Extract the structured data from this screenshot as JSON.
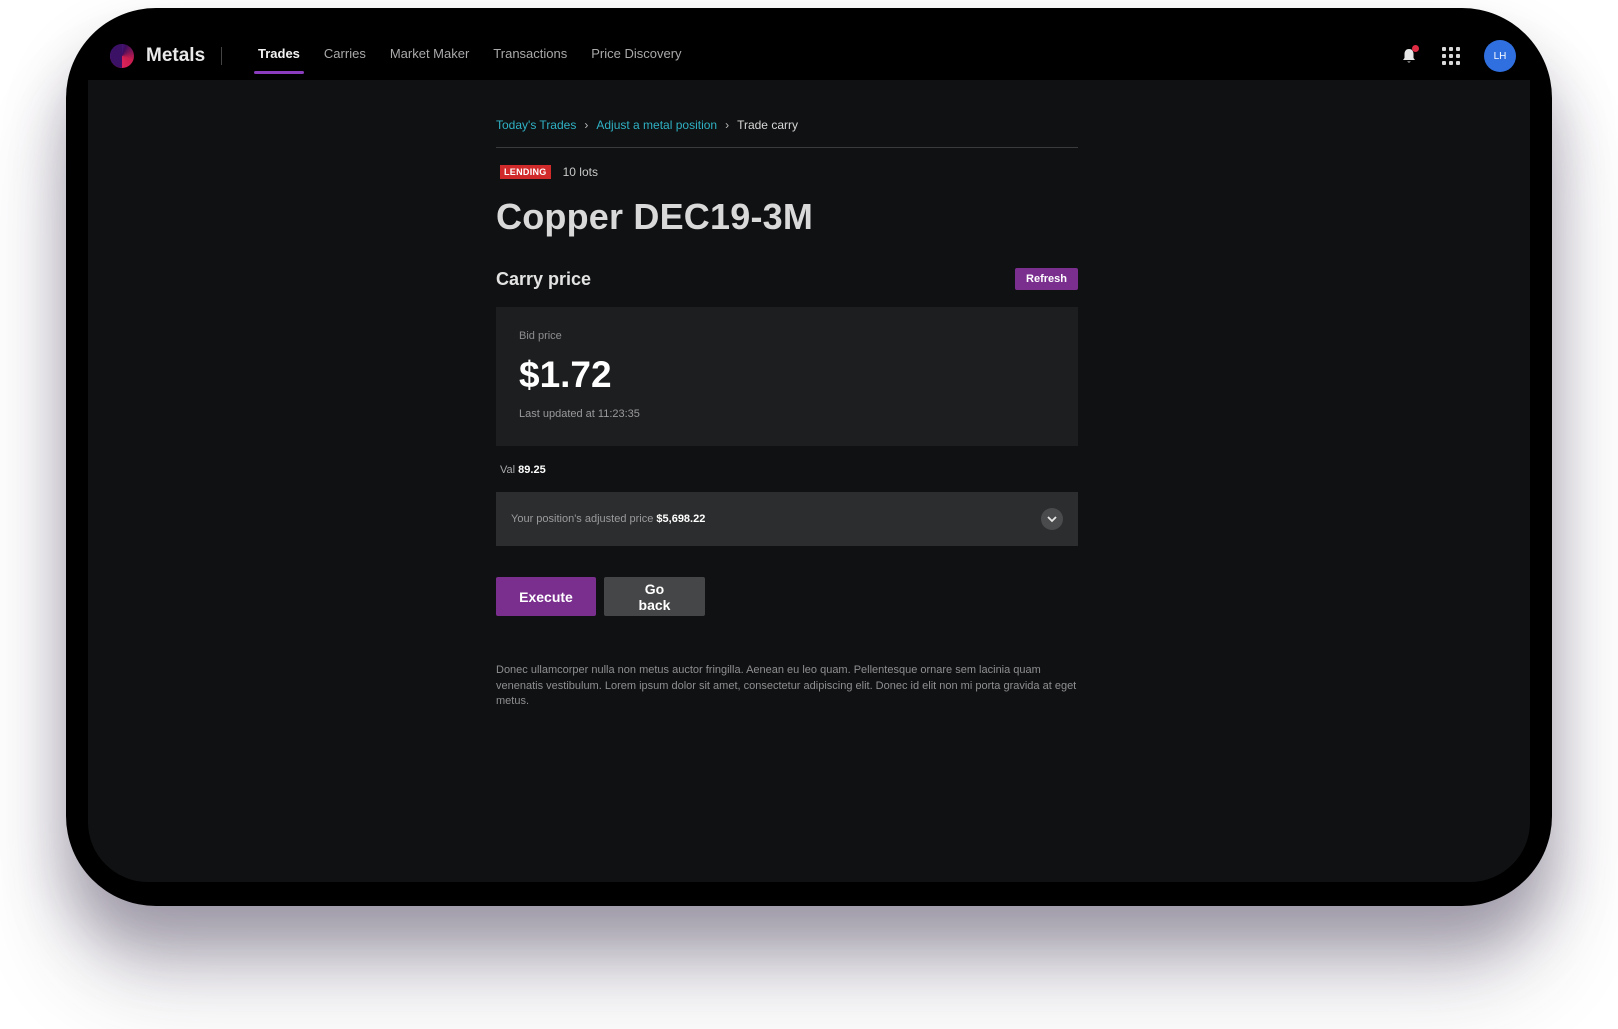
{
  "app": {
    "name": "Metals"
  },
  "nav": {
    "links": [
      {
        "label": "Trades",
        "active": true
      },
      {
        "label": "Carries",
        "active": false
      },
      {
        "label": "Market Maker",
        "active": false
      },
      {
        "label": "Transactions",
        "active": false
      },
      {
        "label": "Price Discovery",
        "active": false
      }
    ],
    "avatar_initials": "LH",
    "notification_dot_color": "#e02c43"
  },
  "breadcrumb": {
    "items": [
      "Today's Trades",
      "Adjust a metal position"
    ],
    "current": "Trade carry"
  },
  "trade": {
    "badge": "LENDING",
    "lots": "10 lots",
    "title": "Copper DEC19-3M"
  },
  "carry": {
    "heading": "Carry price",
    "refresh_label": "Refresh",
    "bid_label": "Bid price",
    "bid_price": "$1.72",
    "last_updated": "Last updated at 11:23:35"
  },
  "val": {
    "label": "Val",
    "value": "89.25"
  },
  "adjusted": {
    "label": "Your position's adjusted price",
    "value": "$5,698.22"
  },
  "actions": {
    "execute_label": "Execute",
    "back_label": "Go back"
  },
  "description": "Donec ullamcorper nulla non metus auctor fringilla. Aenean eu leo quam. Pellentesque ornare sem lacinia quam venenatis vestibulum. Lorem ipsum dolor sit amet, consectetur adipiscing elit. Donec id elit non mi porta gravida at eget metus.",
  "colors": {
    "accent": "#7a2f8f",
    "link": "#2fb1c4",
    "badge": "#d12a2a",
    "avatar": "#2f6fe0"
  }
}
